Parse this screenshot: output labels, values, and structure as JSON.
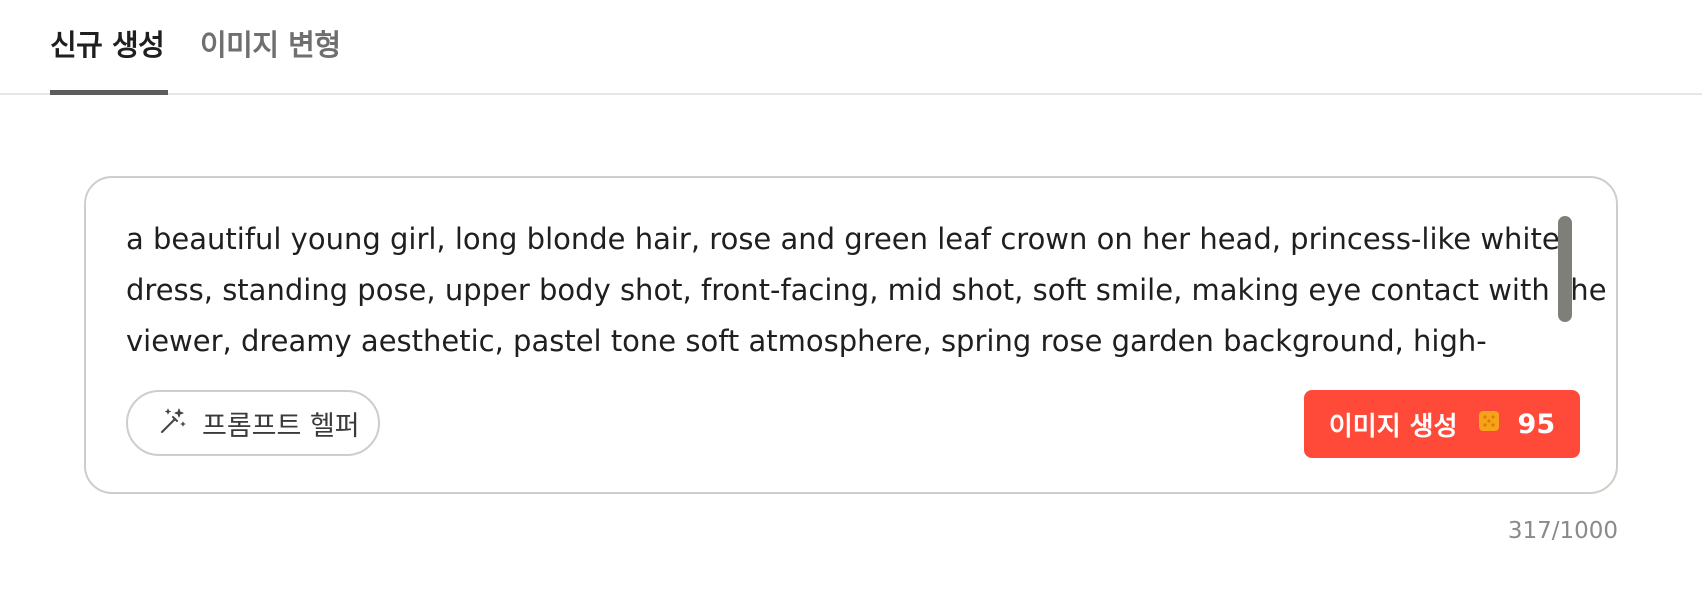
{
  "tabs": [
    {
      "label": "신규 생성",
      "active": true
    },
    {
      "label": "이미지 변형",
      "active": false
    }
  ],
  "prompt": {
    "text": "a beautiful young girl, long blonde hair, rose and green leaf crown on her head, princess-like white dress, standing pose, upper body shot, front-facing, mid shot, soft smile, making eye contact with the viewer, dreamy aesthetic, pastel tone soft atmosphere, spring rose garden background, high-"
  },
  "helper_button": {
    "label": "프롬프트 헬퍼",
    "icon": "magic-wand-icon"
  },
  "generate_button": {
    "label": "이미지 생성",
    "cost": "95",
    "icon": "coin-icon"
  },
  "char_count": "317/1000",
  "colors": {
    "accent": "#ff4a3a",
    "coin": "#f7a21b"
  }
}
